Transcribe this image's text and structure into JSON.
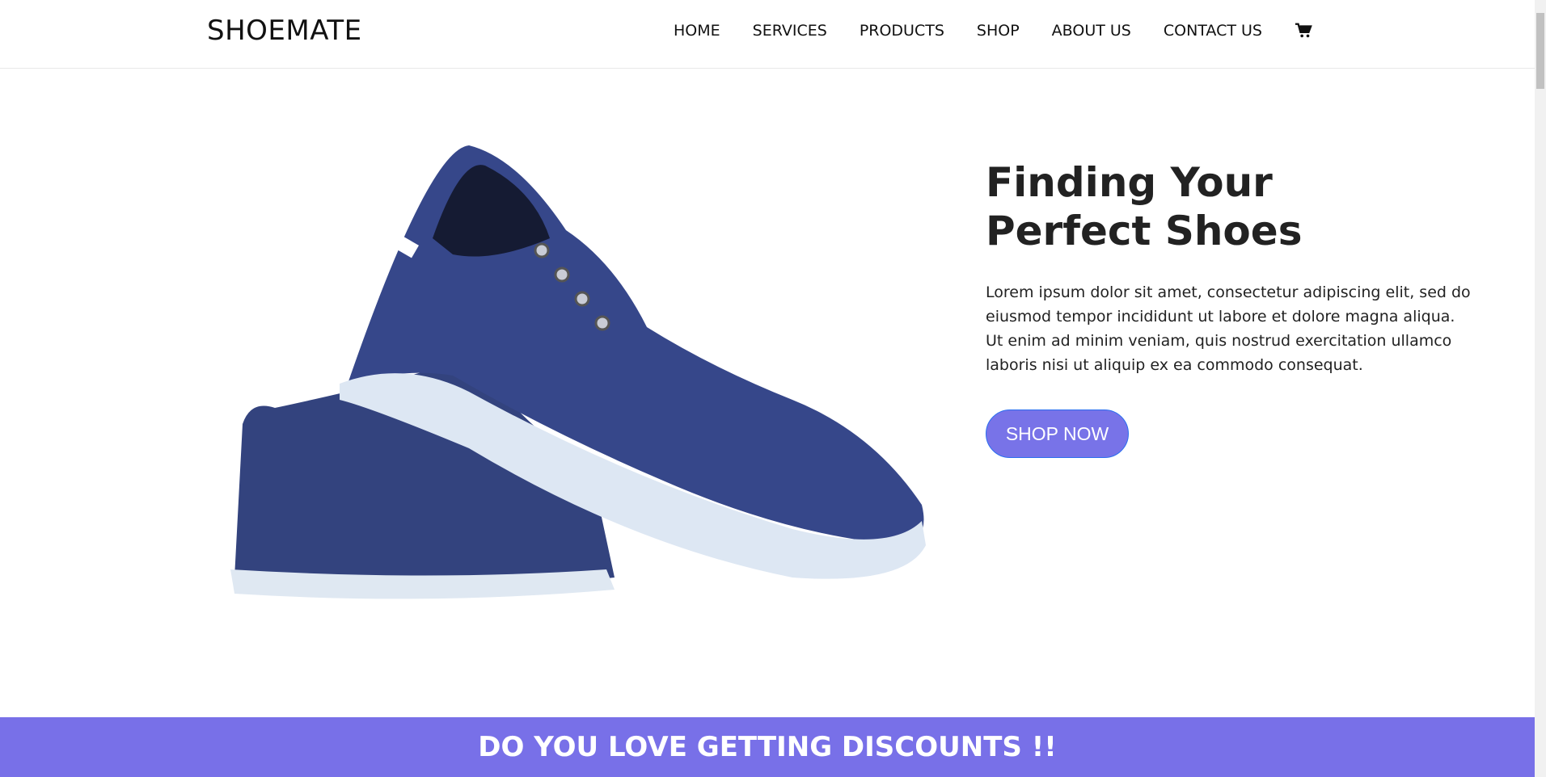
{
  "header": {
    "logo": "SHOEMATE",
    "nav": [
      "HOME",
      "SERVICES",
      "PRODUCTS",
      "SHOP",
      "ABOUT US",
      "CONTACT US"
    ],
    "cart_icon": "shopping-cart-icon"
  },
  "hero": {
    "title": "Finding Your Perfect Shoes",
    "text": "Lorem ipsum dolor sit amet, consectetur adipiscing elit, sed do eiusmod tempor incididunt ut labore et dolore magna aliqua. Ut enim ad minim veniam, quis nostrud exercitation ullamco laboris nisi ut aliquip ex ea commodo consequat.",
    "button": "SHOP NOW",
    "accent": "#7873e8"
  },
  "banner": {
    "title": "DO YOU LOVE GETTING DISCOUNTS !!",
    "color": "#7870e8"
  }
}
